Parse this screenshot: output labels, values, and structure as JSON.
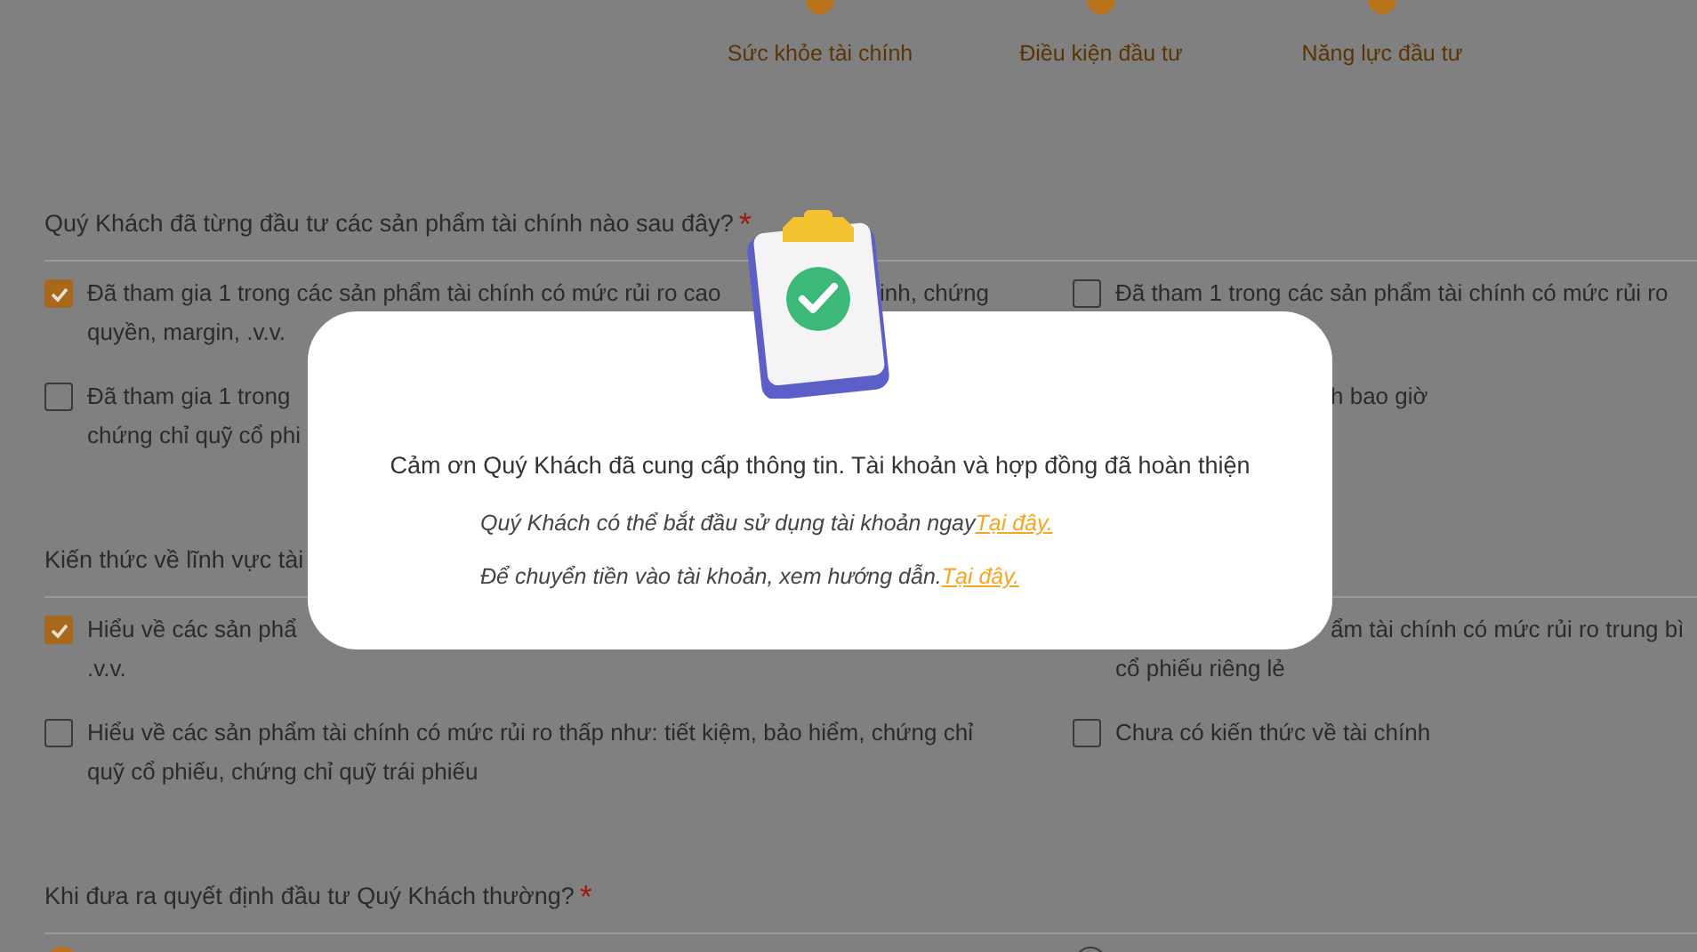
{
  "steps": [
    {
      "label": "Sức khỏe tài chính"
    },
    {
      "label": "Điều kiện đầu tư"
    },
    {
      "label": "Năng lực đầu tư"
    }
  ],
  "sections": [
    {
      "question": "Quý Khách đã từng đầu tư các sản phẩm tài chính nào sau đây?",
      "required_mark": "*",
      "kind": "checkbox",
      "options": [
        {
          "kind": "box",
          "checked": true,
          "lines": [
            [
              "Đã tham gia 1 trong các sản phẩm tài chính có mức rủi ro cao",
              "inh, chứng"
            ],
            [
              "quyền, margin, .v.v."
            ]
          ]
        },
        {
          "kind": "box",
          "checked": false,
          "lines": [
            [
              "Đã tham 1 trong các sản phẩm tài chính có mức rủi ro"
            ]
          ]
        },
        {
          "kind": "box",
          "checked": false,
          "lines": [
            [
              "Đã tham gia 1 trong"
            ],
            [
              "chứng chỉ quỹ cổ phi"
            ]
          ]
        },
        {
          "kind": "covered",
          "lines": [
            [
              "h bao giờ"
            ]
          ]
        }
      ]
    },
    {
      "question": "Kiến thức về lĩnh vực tài",
      "kind": "checkbox",
      "options": [
        {
          "kind": "box",
          "checked": true,
          "lines": [
            [
              "Hiểu về các sản phẩ"
            ],
            [
              ".v.v."
            ]
          ]
        },
        {
          "kind": "covered",
          "lines": [
            [
              "ẩm tài chính có mức rủi ro trung bì"
            ],
            [
              "cổ phiếu riêng lẻ"
            ]
          ]
        },
        {
          "kind": "box",
          "checked": false,
          "lines": [
            [
              "Hiểu về các sản phẩm tài chính có mức rủi ro thấp như: tiết kiệm, bảo hiểm, chứng chỉ"
            ],
            [
              "quỹ cổ phiếu, chứng chỉ quỹ trái phiếu"
            ]
          ]
        },
        {
          "kind": "box",
          "checked": false,
          "lines": [
            [
              "Chưa có kiến thức về tài chính"
            ]
          ]
        }
      ]
    },
    {
      "question": "Khi đưa ra quyết định đầu tư Quý Khách thường?",
      "required_mark": "*",
      "kind": "radio",
      "options": [
        {
          "selected": true
        },
        {
          "selected": false
        }
      ]
    }
  ],
  "dialog": {
    "message": "Cảm ơn Quý Khách đã cung cấp thông tin. Tài khoản và hợp đồng đã hoàn thiện",
    "notes": [
      {
        "text": "Quý Khách có thể bắt đầu sử dụng tài khoản ngay",
        "link": "Tại đây."
      },
      {
        "text": "Để chuyển tiền vào tài khoản, xem hướng dẫn.",
        "link": "Tại đây."
      }
    ]
  }
}
